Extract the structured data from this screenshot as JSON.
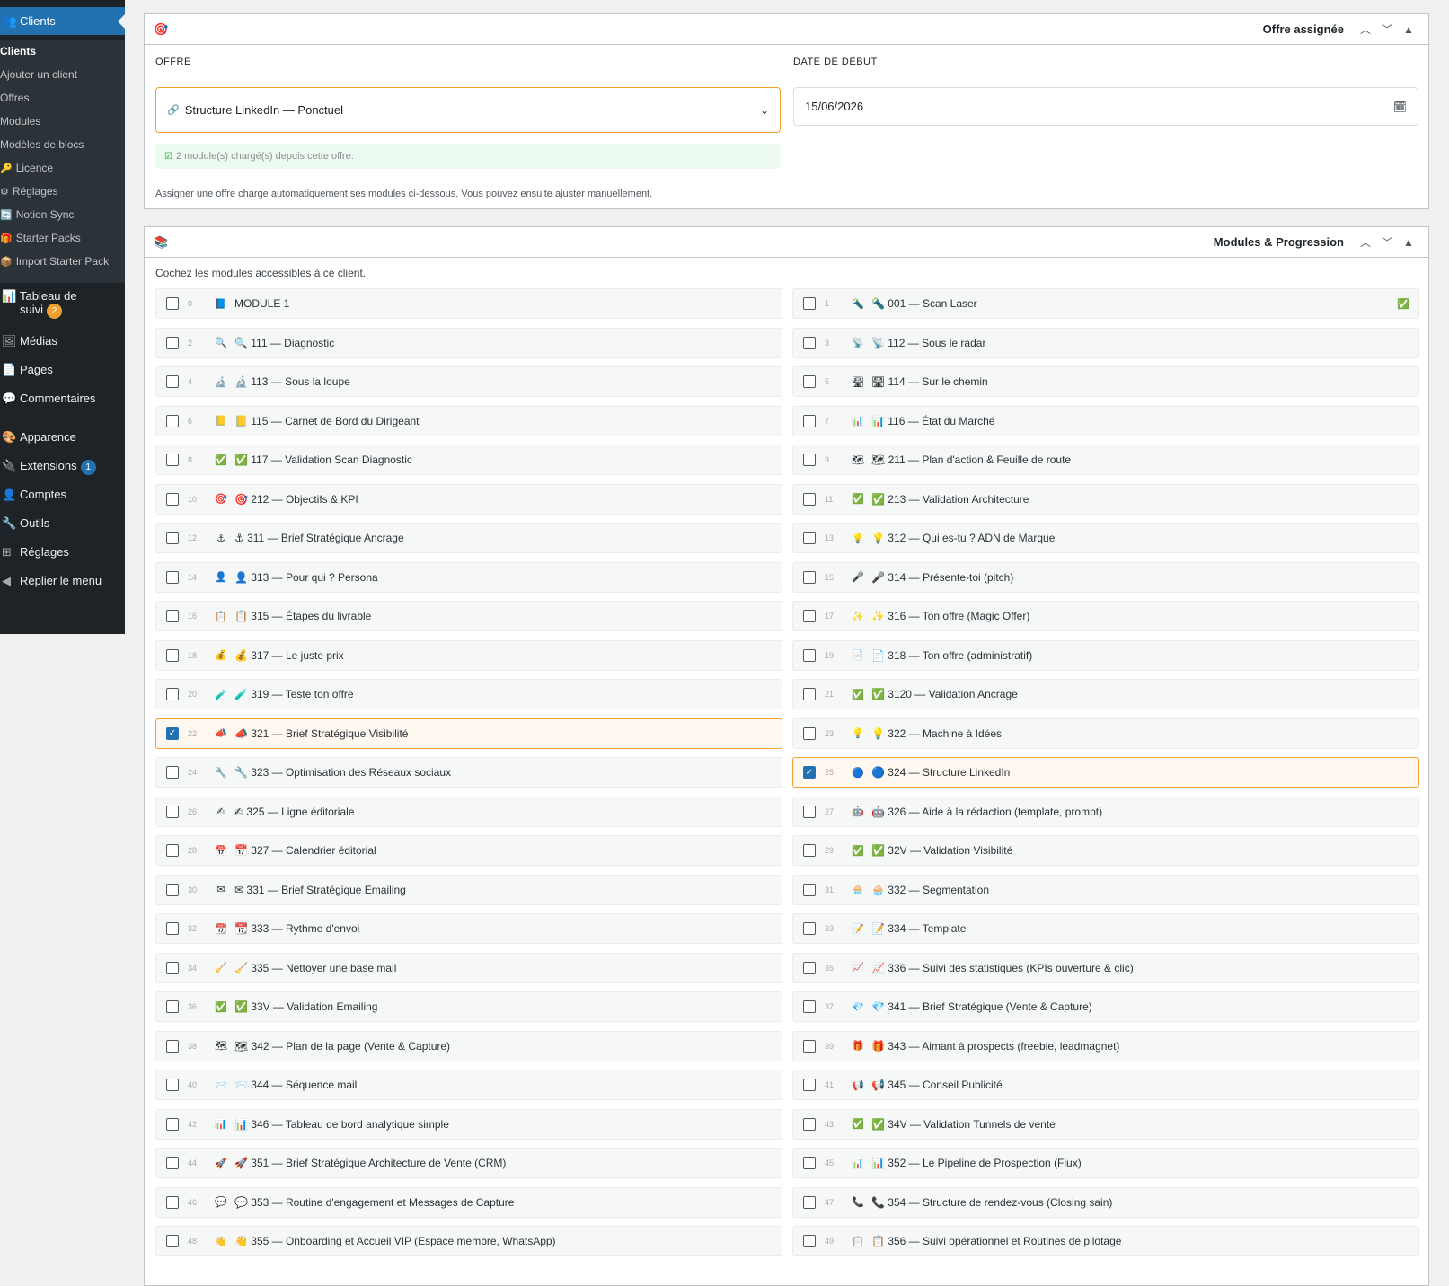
{
  "sidebar": {
    "current": {
      "icon": "👥",
      "label": "Clients"
    },
    "subitems": [
      {
        "label": "Clients",
        "active": true,
        "icon": ""
      },
      {
        "label": "Ajouter un client",
        "icon": ""
      },
      {
        "label": "Offres",
        "icon": ""
      },
      {
        "label": "Modules",
        "icon": ""
      },
      {
        "label": "Modèles de blocs",
        "icon": ""
      },
      {
        "label": "Licence",
        "icon": "🔑"
      },
      {
        "label": "Réglages",
        "icon": "⚙"
      },
      {
        "label": "Notion Sync",
        "icon": "🔄"
      },
      {
        "label": "Starter Packs",
        "icon": "🎁"
      },
      {
        "label": "Import Starter Pack",
        "icon": "📦"
      }
    ],
    "menu": [
      {
        "icon": "📊",
        "label": "Tableau de",
        "label2": "suivi",
        "badge": "2"
      },
      {
        "icon": "🖼",
        "label": "Médias"
      },
      {
        "icon": "📄",
        "label": "Pages"
      },
      {
        "icon": "💬",
        "label": "Commentaires"
      },
      {
        "icon": "🎨",
        "label": "Apparence"
      },
      {
        "icon": "🔌",
        "label": "Extensions",
        "badge": "1"
      },
      {
        "icon": "👤",
        "label": "Comptes"
      },
      {
        "icon": "🔧",
        "label": "Outils"
      },
      {
        "icon": "⊞",
        "label": "Réglages"
      },
      {
        "icon": "◀",
        "label": "Replier le menu"
      }
    ]
  },
  "offer_panel": {
    "icon": "🎯",
    "title": "Offre assignée",
    "offer_label": "OFFRE",
    "offer_value": "Structure LinkedIn — Ponctuel",
    "offer_icon": "🔗",
    "date_label": "DATE DE DÉBUT",
    "date_value": "15/06/2026",
    "notice": "2 module(s) chargé(s) depuis cette offre.",
    "help": "Assigner une offre charge automatiquement ses modules ci-dessous. Vous pouvez ensuite ajuster manuellement."
  },
  "modules_panel": {
    "icon": "📚",
    "title": "Modules & Progression",
    "intro": "Cochez les modules accessibles à ce client.",
    "modules": [
      {
        "idx": "0",
        "icon": "📘",
        "label": "MODULE 1",
        "checked": false
      },
      {
        "idx": "1",
        "icon": "🔦",
        "label": "🔦 001 — Scan Laser",
        "checked": false,
        "status": "✅"
      },
      {
        "idx": "2",
        "icon": "🔍",
        "label": "🔍 111 — Diagnostic",
        "checked": false
      },
      {
        "idx": "3",
        "icon": "📡",
        "label": "📡 112 — Sous le radar",
        "checked": false
      },
      {
        "idx": "4",
        "icon": "🔬",
        "label": "🔬 113 — Sous la loupe",
        "checked": false
      },
      {
        "idx": "5",
        "icon": "🛣",
        "label": "🛣 114 — Sur le chemin",
        "checked": false
      },
      {
        "idx": "6",
        "icon": "📒",
        "label": "📒 115 — Carnet de Bord du Dirigeant",
        "checked": false
      },
      {
        "idx": "7",
        "icon": "📊",
        "label": "📊 116 — État du Marché",
        "checked": false
      },
      {
        "idx": "8",
        "icon": "✅",
        "label": "✅ 117 — Validation Scan Diagnostic",
        "checked": false
      },
      {
        "idx": "9",
        "icon": "🗺",
        "label": "🗺 211 — Plan d'action & Feuille de route",
        "checked": false
      },
      {
        "idx": "10",
        "icon": "🎯",
        "label": "🎯 212 — Objectifs & KPI",
        "checked": false
      },
      {
        "idx": "11",
        "icon": "✅",
        "label": "✅ 213 — Validation Architecture",
        "checked": false
      },
      {
        "idx": "12",
        "icon": "⚓",
        "label": "⚓ 311 — Brief Stratégique Ancrage",
        "checked": false
      },
      {
        "idx": "13",
        "icon": "💡",
        "label": "💡 312 — Qui es-tu ? ADN de Marque",
        "checked": false
      },
      {
        "idx": "14",
        "icon": "👤",
        "label": "👤 313 — Pour qui ? Persona",
        "checked": false
      },
      {
        "idx": "15",
        "icon": "🎤",
        "label": "🎤 314 — Présente-toi (pitch)",
        "checked": false
      },
      {
        "idx": "16",
        "icon": "📋",
        "label": "📋 315 — Étapes du livrable",
        "checked": false
      },
      {
        "idx": "17",
        "icon": "✨",
        "label": "✨ 316 — Ton offre (Magic Offer)",
        "checked": false
      },
      {
        "idx": "18",
        "icon": "💰",
        "label": "💰 317 — Le juste prix",
        "checked": false
      },
      {
        "idx": "19",
        "icon": "📄",
        "label": "📄 318 — Ton offre (administratif)",
        "checked": false
      },
      {
        "idx": "20",
        "icon": "🧪",
        "label": "🧪 319 — Teste ton offre",
        "checked": false
      },
      {
        "idx": "21",
        "icon": "✅",
        "label": "✅ 3120 — Validation Ancrage",
        "checked": false
      },
      {
        "idx": "22",
        "icon": "📣",
        "label": "📣 321 — Brief Stratégique Visibilité",
        "checked": true
      },
      {
        "idx": "23",
        "icon": "💡",
        "label": "💡 322 — Machine à Idées",
        "checked": false
      },
      {
        "idx": "24",
        "icon": "🔧",
        "label": "🔧 323 — Optimisation des Réseaux sociaux",
        "checked": false
      },
      {
        "idx": "25",
        "icon": "🔵",
        "label": "🔵 324 — Structure LinkedIn",
        "checked": true
      },
      {
        "idx": "26",
        "icon": "✍",
        "label": "✍ 325 — Ligne éditoriale",
        "checked": false
      },
      {
        "idx": "27",
        "icon": "🤖",
        "label": "🤖 326 — Aide à la rédaction (template, prompt)",
        "checked": false
      },
      {
        "idx": "28",
        "icon": "📅",
        "label": "📅 327 — Calendrier éditorial",
        "checked": false
      },
      {
        "idx": "29",
        "icon": "✅",
        "label": "✅ 32V — Validation Visibilité",
        "checked": false
      },
      {
        "idx": "30",
        "icon": "✉",
        "label": "✉ 331 — Brief Stratégique Emailing",
        "checked": false
      },
      {
        "idx": "31",
        "icon": "🧁",
        "label": "🧁 332 — Segmentation",
        "checked": false
      },
      {
        "idx": "32",
        "icon": "📆",
        "label": "📆 333 — Rythme d'envoi",
        "checked": false
      },
      {
        "idx": "33",
        "icon": "📝",
        "label": "📝 334 — Template",
        "checked": false
      },
      {
        "idx": "34",
        "icon": "🧹",
        "label": "🧹 335 — Nettoyer une base mail",
        "checked": false
      },
      {
        "idx": "35",
        "icon": "📈",
        "label": "📈 336 — Suivi des statistiques (KPIs ouverture & clic)",
        "checked": false
      },
      {
        "idx": "36",
        "icon": "✅",
        "label": "✅ 33V — Validation Emailing",
        "checked": false
      },
      {
        "idx": "37",
        "icon": "💎",
        "label": "💎 341 — Brief Stratégique (Vente & Capture)",
        "checked": false
      },
      {
        "idx": "38",
        "icon": "🗺",
        "label": "🗺 342 — Plan de la page (Vente & Capture)",
        "checked": false
      },
      {
        "idx": "39",
        "icon": "🎁",
        "label": "🎁 343 — Aimant à prospects (freebie, leadmagnet)",
        "checked": false
      },
      {
        "idx": "40",
        "icon": "📨",
        "label": "📨 344 — Séquence mail",
        "checked": false
      },
      {
        "idx": "41",
        "icon": "📢",
        "label": "📢 345 — Conseil Publicité",
        "checked": false
      },
      {
        "idx": "42",
        "icon": "📊",
        "label": "📊 346 — Tableau de bord analytique simple",
        "checked": false
      },
      {
        "idx": "43",
        "icon": "✅",
        "label": "✅ 34V — Validation Tunnels de vente",
        "checked": false
      },
      {
        "idx": "44",
        "icon": "🚀",
        "label": "🚀 351 — Brief Stratégique Architecture de Vente (CRM)",
        "checked": false
      },
      {
        "idx": "45",
        "icon": "📊",
        "label": "📊 352 — Le Pipeline de Prospection (Flux)",
        "checked": false
      },
      {
        "idx": "46",
        "icon": "💬",
        "label": "💬 353 — Routine d'engagement et Messages de Capture",
        "checked": false
      },
      {
        "idx": "47",
        "icon": "📞",
        "label": "📞 354 — Structure de rendez-vous (Closing sain)",
        "checked": false
      },
      {
        "idx": "48",
        "icon": "👋",
        "label": "👋 355 — Onboarding et Accueil VIP (Espace membre, WhatsApp)",
        "checked": false
      },
      {
        "idx": "49",
        "icon": "📋",
        "label": "📋 356 — Suivi opérationnel et Routines de pilotage",
        "checked": false
      }
    ]
  }
}
